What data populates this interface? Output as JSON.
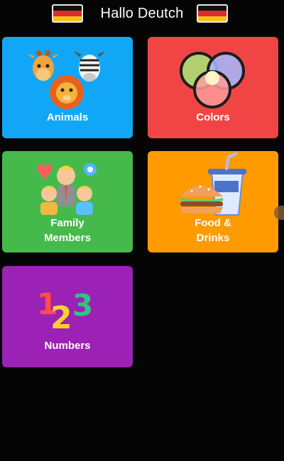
{
  "header": {
    "title": "Hallo Deutch",
    "flag_colors": [
      "#111111",
      "#dd2d2d",
      "#f3c21b"
    ],
    "left_flag_icon": "german-flag-icon",
    "right_flag_icon": "german-flag-icon"
  },
  "categories": [
    {
      "label_lines": [
        "Animals"
      ],
      "color": "#12a7f6",
      "icon": "animals-icon"
    },
    {
      "label_lines": [
        "Colors"
      ],
      "color": "#f14545",
      "icon": "colors-icon"
    },
    {
      "label_lines": [
        "Family",
        "Members"
      ],
      "color": "#45ba4b",
      "icon": "family-icon"
    },
    {
      "label_lines": [
        "Food &",
        "Drinks"
      ],
      "color": "#ff9a00",
      "icon": "food-drinks-icon"
    },
    {
      "label_lines": [
        "Numbers"
      ],
      "color": "#9c21b5",
      "icon": "numbers-icon"
    }
  ]
}
